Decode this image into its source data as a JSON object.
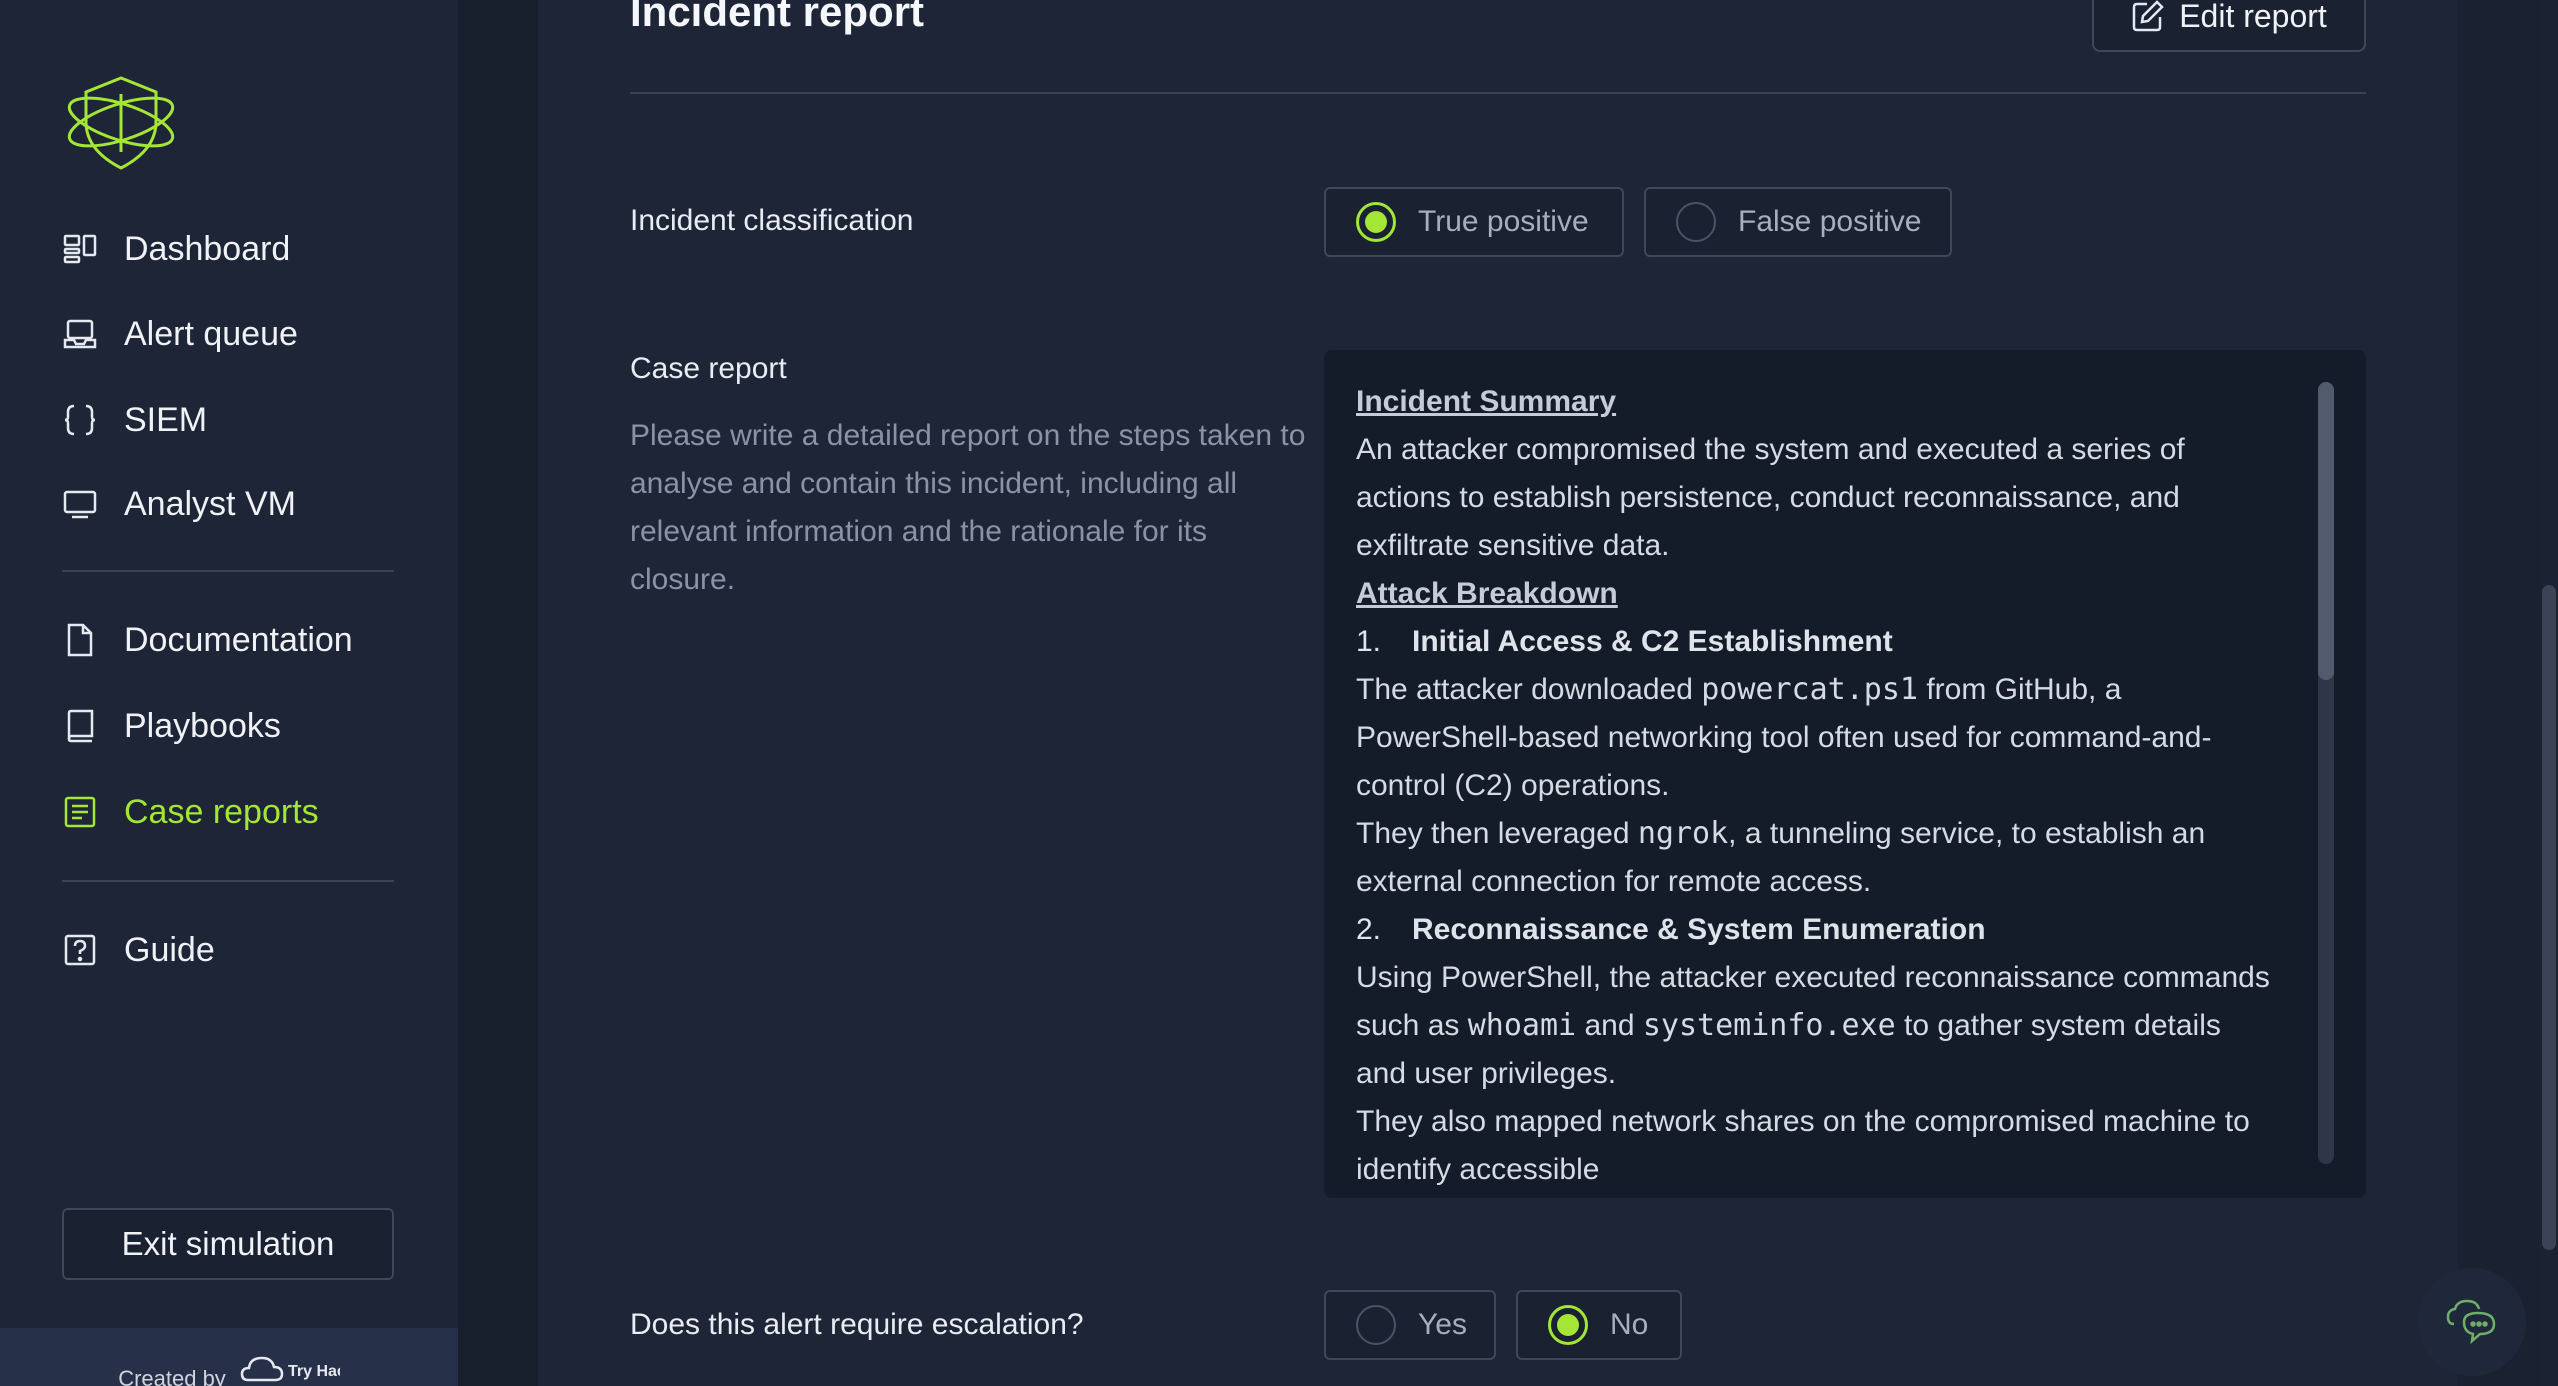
{
  "sidebar": {
    "nav_primary": [
      {
        "label": "Dashboard",
        "icon": "dashboard-icon"
      },
      {
        "label": "Alert queue",
        "icon": "inbox-icon"
      },
      {
        "label": "SIEM",
        "icon": "braces-icon"
      },
      {
        "label": "Analyst VM",
        "icon": "monitor-icon"
      }
    ],
    "nav_secondary": [
      {
        "label": "Documentation",
        "icon": "document-icon"
      },
      {
        "label": "Playbooks",
        "icon": "book-icon"
      },
      {
        "label": "Case reports",
        "icon": "report-icon",
        "active": true
      }
    ],
    "nav_tertiary": [
      {
        "label": "Guide",
        "icon": "question-icon"
      }
    ],
    "exit_label": "Exit simulation",
    "created_by": "Created by",
    "brand_logo_text": "Try Hack"
  },
  "header": {
    "title": "Incident report",
    "edit_label": "Edit report"
  },
  "classification": {
    "label": "Incident classification",
    "options": [
      "True positive",
      "False positive"
    ],
    "selected": "True positive"
  },
  "case_report": {
    "label": "Case report",
    "help": "Please write a detailed report on the steps taken to analyse and contain this incident, including all relevant information and the rationale for its closure.",
    "summary_heading": "Incident Summary",
    "summary_text": "An attacker compromised the system and executed a series of actions to establish persistence, conduct reconnaissance, and exfiltrate sensitive data.",
    "breakdown_heading": "Attack Breakdown",
    "step1_num": "1.",
    "step1_title": "Initial Access & C2 Establishment",
    "step1_p1_a": "The attacker downloaded ",
    "step1_p1_code": "powercat.ps1",
    "step1_p1_b": " from GitHub, a PowerShell-based networking tool often used for command-and-control (C2) operations.",
    "step1_p2_a": "They then leveraged ",
    "step1_p2_code": "ngrok",
    "step1_p2_b": ", a tunneling service, to establish an external connection for remote access.",
    "step2_num": "2.",
    "step2_title": "Reconnaissance & System Enumeration",
    "step2_p1_a": "Using PowerShell, the attacker executed reconnaissance commands such as ",
    "step2_p1_code1": "whoami",
    "step2_p1_mid": " and ",
    "step2_p1_code2": "systeminfo.exe",
    "step2_p1_b": " to gather system details and user privileges.",
    "step2_p2": "They also mapped network shares on the compromised machine to identify accessible"
  },
  "escalation": {
    "label": "Does this alert require escalation?",
    "options": [
      "Yes",
      "No"
    ],
    "selected": "No"
  },
  "colors": {
    "accent": "#a3e635",
    "background": "#1b2333"
  }
}
